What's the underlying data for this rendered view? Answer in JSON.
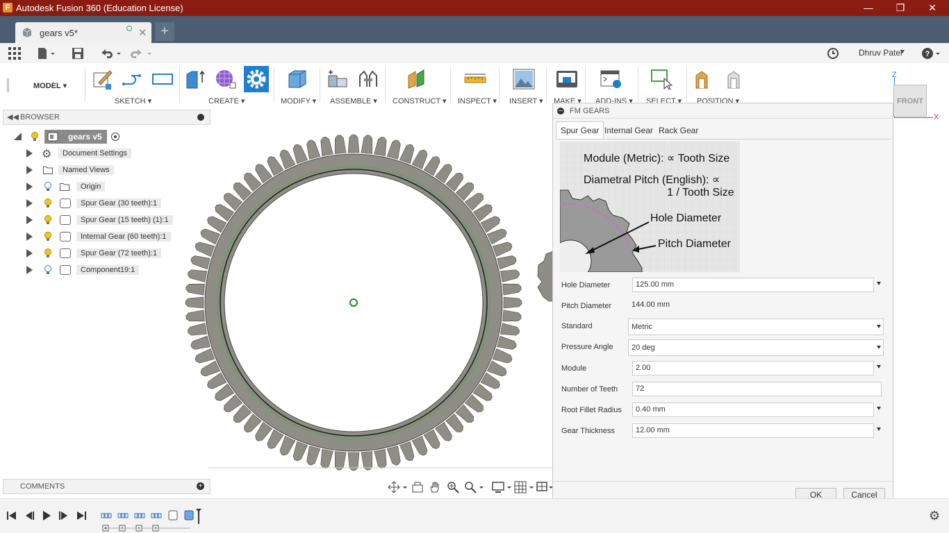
{
  "window": {
    "title": "Autodesk Fusion 360 (Education License)",
    "app_icon": "F"
  },
  "tabs": {
    "doc_name": "gears v5*",
    "new_tab": "+"
  },
  "user": {
    "name": "Dhruv Patel"
  },
  "toolbar": {
    "mode": "MODEL",
    "groups": [
      "SKETCH",
      "CREATE",
      "MODIFY",
      "ASSEMBLE",
      "CONSTRUCT",
      "INSPECT",
      "INSERT",
      "MAKE",
      "ADD-INS",
      "SELECT",
      "POSITION"
    ]
  },
  "browser": {
    "title": "BROWSER",
    "root": "gears v5",
    "items": [
      {
        "label": "Document Settings",
        "icon": "gear-icon"
      },
      {
        "label": "Named Views",
        "icon": "folder-icon"
      },
      {
        "label": "Origin",
        "icon": "folder-icon",
        "bulb": "blue"
      },
      {
        "label": "Spur Gear (30 teeth):1",
        "icon": "component-icon",
        "bulb": "yellow"
      },
      {
        "label": "Spur Gear (15 teeth) (1):1",
        "icon": "component-icon",
        "bulb": "yellow"
      },
      {
        "label": "Internal Gear (60 teeth):1",
        "icon": "component-icon",
        "bulb": "yellow"
      },
      {
        "label": "Spur Gear (72 teeth):1",
        "icon": "component-icon",
        "bulb": "yellow"
      },
      {
        "label": "Component19:1",
        "icon": "component-icon",
        "bulb": "blue"
      }
    ]
  },
  "comments": {
    "title": "COMMENTS"
  },
  "viewcube": {
    "face": "FRONT",
    "z": "Z",
    "x": "X"
  },
  "dialog": {
    "title": "FM GEARS",
    "tabs": [
      "Spur Gear",
      "Internal Gear",
      "Rack Gear"
    ],
    "active_tab": "Spur Gear",
    "diagram": {
      "line1": "Module (Metric): ∝ Tooth Size",
      "line2": "Diametral Pitch (English): ∝",
      "line3": "1 / Tooth Size",
      "hole": "Hole Diameter",
      "pitch": "Pitch Diameter"
    },
    "fields": {
      "hole_diameter": {
        "label": "Hole Diameter",
        "value": "125.00 mm"
      },
      "pitch_diameter": {
        "label": "Pitch Diameter",
        "value": "144.00 mm"
      },
      "standard": {
        "label": "Standard",
        "value": "Metric"
      },
      "pressure_angle": {
        "label": "Pressure Angle",
        "value": "20 deg"
      },
      "module": {
        "label": "Module",
        "value": "2.00"
      },
      "teeth": {
        "label": "Number of Teeth",
        "value": "72"
      },
      "root_fillet": {
        "label": "Root Fillet Radius",
        "value": "0.40 mm"
      },
      "thickness": {
        "label": "Gear Thickness",
        "value": "12.00 mm"
      }
    },
    "ok": "OK",
    "cancel": "Cancel"
  },
  "colors": {
    "titlebar": "#8b1c12",
    "tabbar": "#4b5d70",
    "accent": "#1e7fd0",
    "gear": "#8e8e86"
  }
}
